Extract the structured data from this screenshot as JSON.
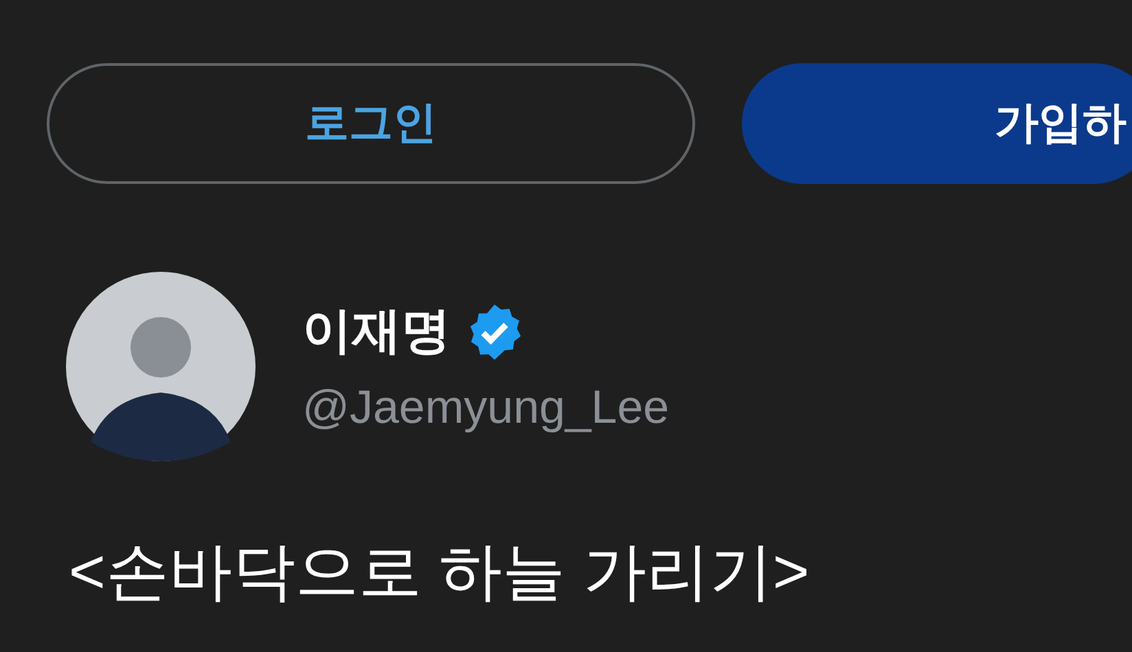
{
  "auth_buttons": [
    {
      "label": "로그인",
      "kind": "outline"
    },
    {
      "label": "가입하",
      "kind": "filled"
    }
  ],
  "tweet": {
    "author": {
      "name": "이재명",
      "verified": true,
      "handle": "@Jaemyung_Lee"
    },
    "text": "<손바닥으로 하늘 가리기>"
  }
}
